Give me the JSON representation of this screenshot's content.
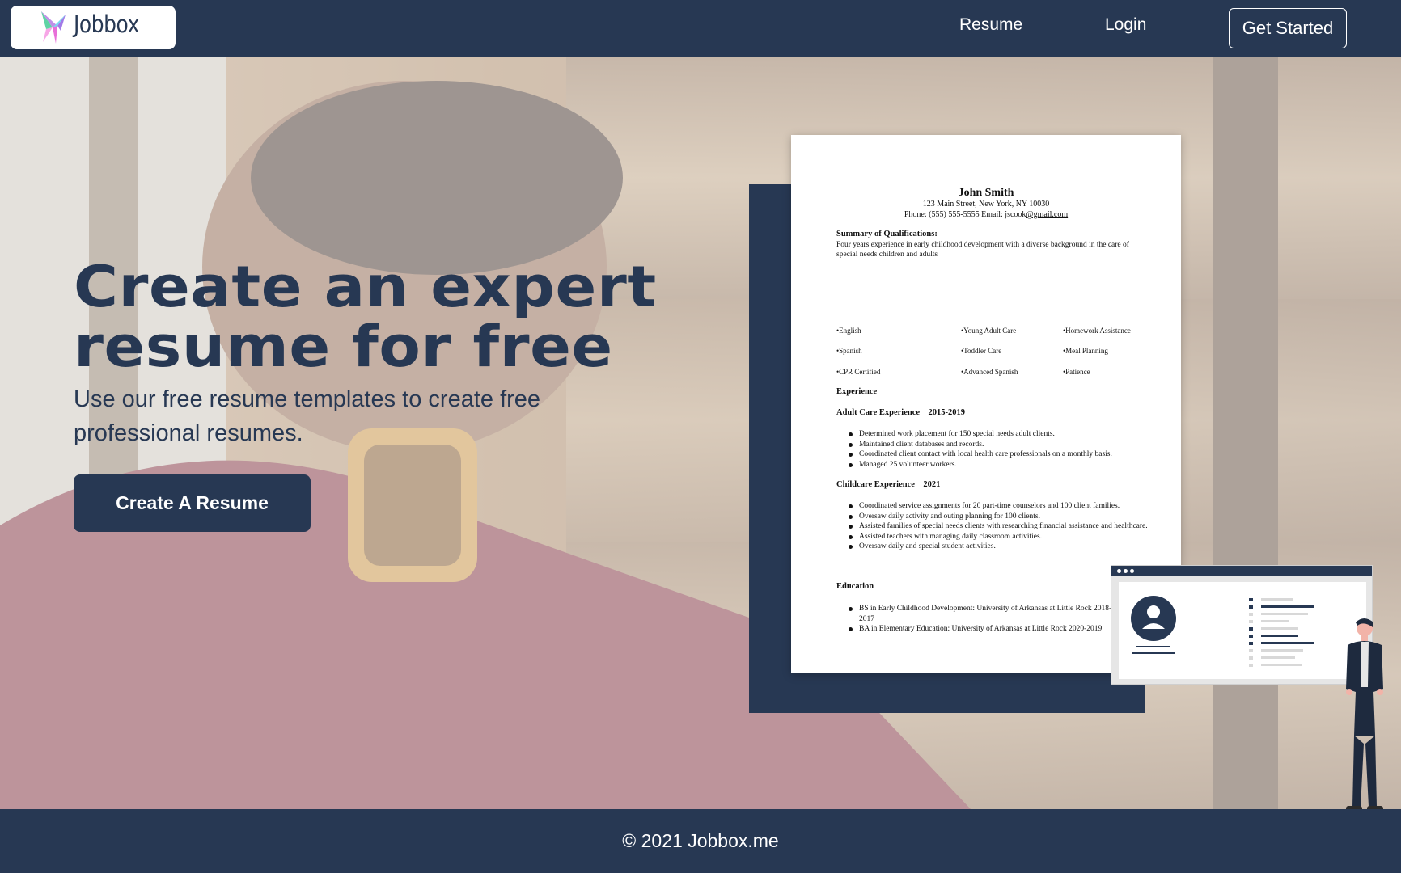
{
  "nav": {
    "logo_text": "Jobbox",
    "links": [
      "Resume",
      "Login"
    ],
    "cta_label": "Get Started"
  },
  "hero": {
    "headline_line1": "Create an expert",
    "headline_line2": "resume for free",
    "subheadline": "Use our free resume templates to create free professional resumes.",
    "cta_label": "Create A Resume"
  },
  "resume": {
    "name": "John Smith",
    "address": "123 Main Street, New York, NY 10030",
    "contact_prefix": "Phone: (555) 555-5555 Email: jscook",
    "contact_email_domain": "@gmail.com",
    "summary_heading": "Summary of Qualifications:",
    "summary_text": "Four years experience in early childhood development with a diverse background in the care of special needs children and adults",
    "skills": [
      "•English",
      "•Young Adult Care",
      "•Homework Assistance",
      "•Spanish",
      "•Toddler Care",
      "•Meal Planning",
      "•CPR Certified",
      "•Advanced Spanish",
      "•Patience"
    ],
    "experience_heading": "Experience",
    "job1_title": "Adult Care Experience    2015-2019",
    "job1_items": [
      "Determined work placement for 150 special needs adult clients.",
      "Maintained client databases and records.",
      " Coordinated client contact with local health care professionals on a monthly basis.",
      " Managed 25 volunteer workers."
    ],
    "job2_title": "Childcare Experience    2021",
    "job2_items": [
      "Coordinated service assignments for 20 part-time counselors and 100 client families.",
      "Oversaw daily activity and outing planning for 100 clients.",
      "Assisted families of special needs clients with researching financial assistance and healthcare.",
      "Assisted teachers with managing daily classroom activities.",
      "Oversaw daily and special student activities."
    ],
    "education_heading": "Education",
    "education_items": [
      "BS in Early Childhood Development: University of Arkansas at Little Rock 2018-2017",
      "BA in Elementary Education: University of Arkansas at Little Rock 2020-2019"
    ]
  },
  "footer": {
    "copyright": "© 2021 Jobbox.me"
  },
  "colors": {
    "navy": "#273853",
    "white": "#ffffff"
  },
  "icons": {
    "logo": "paper-plane-logo-icon",
    "avatar": "user-avatar-icon",
    "person": "standing-person-illustration"
  }
}
